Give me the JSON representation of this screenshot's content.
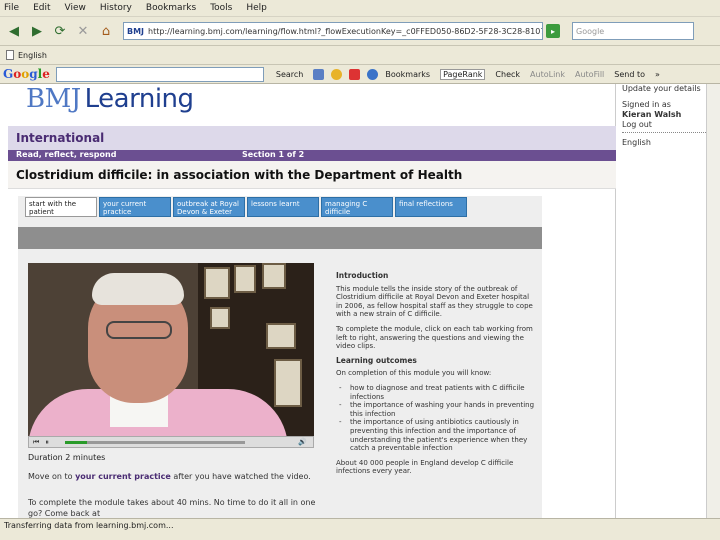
{
  "menu": [
    "File",
    "Edit",
    "View",
    "History",
    "Bookmarks",
    "Tools",
    "Help"
  ],
  "address": {
    "favicon": "BMJ",
    "url": "http://learning.bmj.com/learning/flow.html?_flowExecutionKey=_c0FFED050-86D2-5F28-3C28-8107B037DE...",
    "go_label": "▸"
  },
  "search_placeholder": "Google",
  "bookmark_label": "English",
  "google_toolbar": {
    "search_label": "Search",
    "bookmarks": "Bookmarks",
    "pagerank": "PageRank",
    "check": "Check",
    "autolink": "AutoLink",
    "autofill": "AutoFill",
    "send": "Send to",
    "more": "»"
  },
  "logo": {
    "bmj": "BMJ",
    "learning": "Learning"
  },
  "sidebar": {
    "update": "Update your details",
    "signed_in_as": "Signed in as",
    "name": "Kieran Walsh",
    "logout": "Log out",
    "english": "English"
  },
  "section_title": "International",
  "info_bar": {
    "left": "Read, reflect, respond",
    "right": "Section 1 of 2"
  },
  "module_title": "Clostridium difficile: in association with the Department of Health",
  "tabs": [
    "start with the patient",
    "your current practice",
    "outbreak at Royal Devon & Exeter",
    "lessons learnt",
    "managing C difficile",
    "final reflections"
  ],
  "video": {
    "progress": 0.12,
    "duration": "Duration 2 minutes"
  },
  "move_on": {
    "prefix": "Move on to ",
    "link": "your current practice",
    "suffix": " after you have watched the video."
  },
  "complete_text": "To complete the module takes about 40 mins. No time to do it all in one go? Come back at",
  "right_col": {
    "intro_heading": "Introduction",
    "intro_p1": "This module tells the inside story of the outbreak of Clostridium difficile at Royal Devon and Exeter hospital in 2006, as fellow hospital staff as they struggle to cope with a new strain of C difficile.",
    "intro_p2": "To complete the module, click on each tab working from left to right, answering the questions and viewing the video clips.",
    "outcomes_heading": "Learning outcomes",
    "outcomes_intro": "On completion of this module you will know:",
    "outcomes": [
      "how to diagnose and treat patients with C difficile infections",
      "the importance of washing your hands in preventing this infection",
      "the importance of using antibiotics cautiously in preventing this infection and the importance of understanding the patient's experience when they catch a preventable infection"
    ],
    "about": "About 40 000 people in England develop C difficile infections every year."
  },
  "status": "Transferring data from learning.bmj.com..."
}
